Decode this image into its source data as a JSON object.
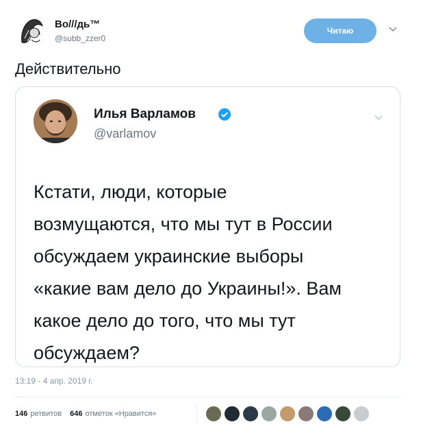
{
  "author": {
    "name": "Во///дь™",
    "handle": "@subb_zzer0"
  },
  "follow_button": "Читаю",
  "tweet_text": "Действительно",
  "quoted": {
    "name": "Илья Варламов",
    "handle": "@varlamov",
    "text": "Кстати, люди, которые\nвозмущаются, что мы тут в России\nобсуждаем украинские выборы\n«какие вам дело до Украины!». Вам\nкакое дело до того, что мы тут\nобсуждаем?"
  },
  "timestamp": "13:19 - 4 апр. 2019 г.",
  "stats": {
    "retweets_count": "146",
    "retweets_label": "ретвитов",
    "likes_count": "646",
    "likes_label": "отметок «Нравится»"
  },
  "likers": [
    {
      "name": "liker-avatar-1",
      "color": "#6b6b55"
    },
    {
      "name": "liker-avatar-2",
      "color": "#1f2a33"
    },
    {
      "name": "liker-avatar-3",
      "color": "#2b3a45"
    },
    {
      "name": "liker-avatar-4",
      "color": "#9aa8a3"
    },
    {
      "name": "liker-avatar-5",
      "color": "#c49a6c"
    },
    {
      "name": "liker-avatar-6",
      "color": "#8b7b78"
    },
    {
      "name": "liker-avatar-7",
      "color": "#2e6bb5"
    },
    {
      "name": "liker-avatar-8",
      "color": "#3a4a3a"
    },
    {
      "name": "liker-avatar-9",
      "color": "#c7ccd1"
    }
  ],
  "colors": {
    "follow_button": "#6db1e6",
    "verified": "#1da1f2",
    "secondary_text": "#657786"
  }
}
